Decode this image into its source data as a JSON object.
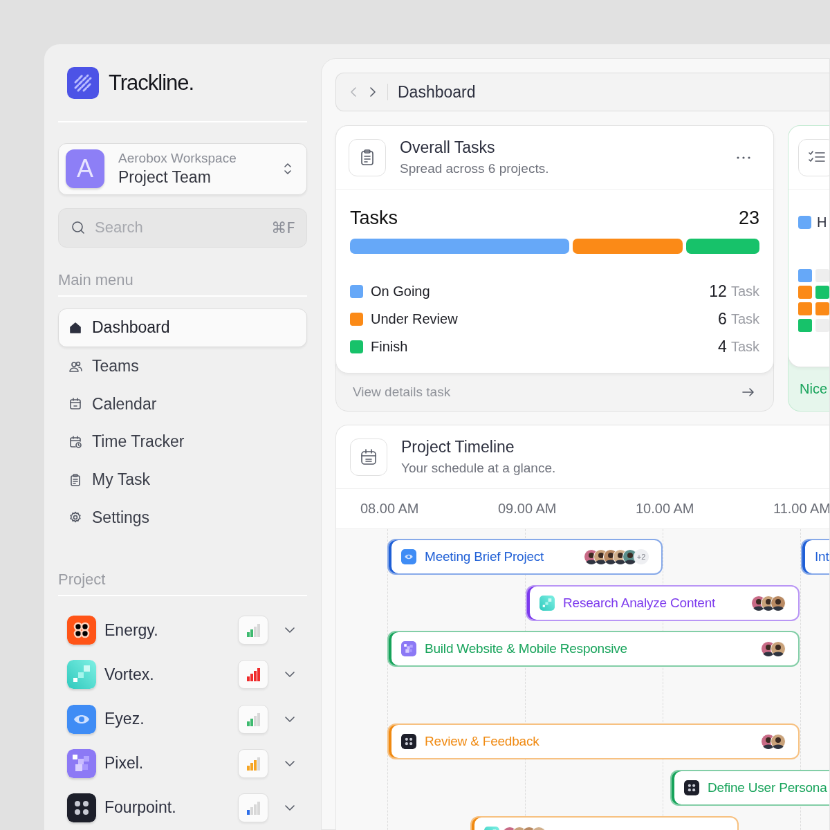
{
  "brand": {
    "name": "Trackline."
  },
  "workspace": {
    "org": "Aerobox Workspace",
    "team": "Project Team",
    "initial": "A"
  },
  "search": {
    "placeholder": "Search",
    "shortcut": "⌘F"
  },
  "main_menu": {
    "title": "Main menu",
    "items": [
      {
        "label": "Dashboard",
        "selected": true
      },
      {
        "label": "Teams",
        "selected": false
      },
      {
        "label": "Calendar",
        "selected": false
      },
      {
        "label": "Time Tracker",
        "selected": false
      },
      {
        "label": "My Task",
        "selected": false
      },
      {
        "label": "Settings",
        "selected": false
      }
    ]
  },
  "projects": {
    "title": "Project",
    "items": [
      {
        "name": "Energy.",
        "kind": "medium",
        "color": "#3dba6f"
      },
      {
        "name": "Vortex.",
        "kind": "urgent",
        "color": "#ef2b2b"
      },
      {
        "name": "Eyez.",
        "kind": "medium",
        "color": "#3dba6f"
      },
      {
        "name": "Pixel.",
        "kind": "high",
        "color": "#f5a524"
      },
      {
        "name": "Fourpoint.",
        "kind": "low",
        "color": "#2f6fe8"
      }
    ]
  },
  "breadcrumb": {
    "title": "Dashboard"
  },
  "overall_tasks": {
    "title": "Overall Tasks",
    "subtitle": "Spread across 6 projects.",
    "label": "Tasks",
    "total": "23",
    "statuses": [
      {
        "name": "On Going",
        "count": "12",
        "unit": "Task",
        "color": "#66a8f8"
      },
      {
        "name": "Under Review",
        "count": "6",
        "unit": "Task",
        "color": "#fb8a17"
      },
      {
        "name": "Finish",
        "count": "4",
        "unit": "Task",
        "color": "#17c26a"
      }
    ],
    "footer": "View details task"
  },
  "second_card": {
    "legend": "H",
    "grid": [
      {
        "color": "#66a8f8"
      },
      {
        "color": "#eeeeee"
      },
      {
        "color": "#fb8a17"
      },
      {
        "color": "#17c26a"
      },
      {
        "color": "#fb8a17"
      },
      {
        "color": "#fb8a17"
      },
      {
        "color": "#17c26a"
      },
      {
        "color": "#eeeeee"
      }
    ],
    "footer": "Nice"
  },
  "timeline": {
    "title": "Project Timeline",
    "subtitle": "Your schedule at a glance.",
    "hours": [
      "08.00 AM",
      "09.00 AM",
      "10.00 AM",
      "11.00 AM"
    ],
    "events": [
      {
        "title": "Meeting Brief Project",
        "color": "#1f5fd6",
        "avatars": [
          {
            "kind": "photo"
          },
          {
            "kind": "photo"
          },
          {
            "kind": "photo"
          },
          {
            "kind": "photo"
          },
          {
            "kind": "photo"
          }
        ],
        "more": "+2"
      },
      {
        "title": "Int",
        "color": "#1f5fd6"
      },
      {
        "title": "Research Analyze Content",
        "color": "#7c3aed",
        "avatars": [
          {
            "kind": "photo"
          },
          {
            "kind": "photo"
          },
          {
            "kind": "photo"
          }
        ]
      },
      {
        "title": "Build Website & Mobile Responsive",
        "color": "#16a35a",
        "avatars": [
          {
            "kind": "photo"
          },
          {
            "kind": "photo"
          }
        ]
      },
      {
        "title": "Review & Feedback",
        "color": "#f08a12",
        "avatars": [
          {
            "kind": "photo"
          },
          {
            "kind": "photo"
          }
        ]
      },
      {
        "title": "Define User Persona",
        "color": "#16a35a"
      },
      {
        "color": "#f08a12",
        "avatars": [
          {
            "kind": "photo"
          },
          {
            "kind": "photo"
          },
          {
            "kind": "photo"
          },
          {
            "kind": "photo"
          }
        ]
      }
    ]
  }
}
